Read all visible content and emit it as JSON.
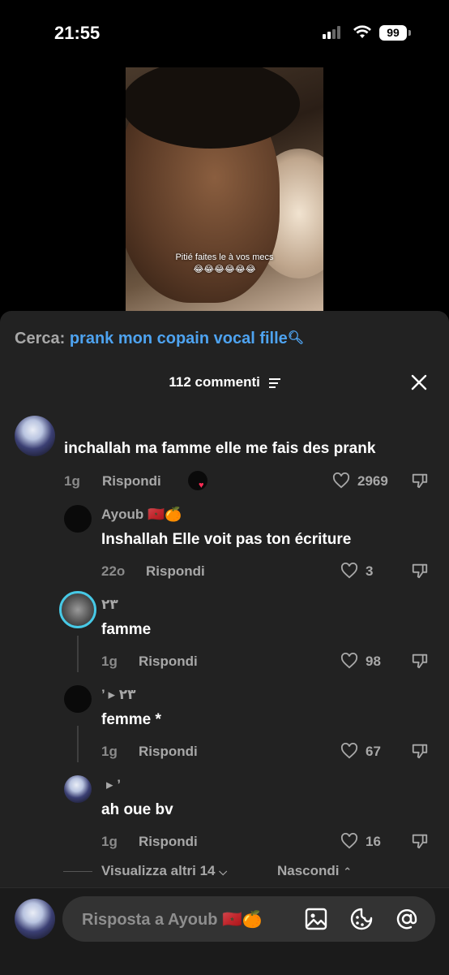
{
  "status_bar": {
    "time": "21:55",
    "battery": "99"
  },
  "video": {
    "caption": "Pitié faites le à vos mecs",
    "caption_emojis": "😂😂😂😂😂😂"
  },
  "search": {
    "label": "Cerca:",
    "query": "prank mon copain vocal fille"
  },
  "comments_header": {
    "count_text": "112 commenti"
  },
  "comments": [
    {
      "name": "",
      "text": "inchallah ma famme elle me fais des prank",
      "age": "1g",
      "reply_label": "Rispondi",
      "likes": "2969"
    },
    {
      "name": "Ayoub 🇲🇦🍊",
      "text": "Inshallah Elle voit pas ton écriture",
      "age": "22o",
      "reply_label": "Rispondi",
      "likes": "3"
    },
    {
      "name": "٢٣",
      "text": "famme",
      "age": "1g",
      "reply_label": "Rispondi",
      "likes": "98"
    },
    {
      "name": "’ ▸ ٢٣",
      "text": "femme *",
      "age": "1g",
      "reply_label": "Rispondi",
      "likes": "67"
    },
    {
      "name": "▸ ’",
      "text": "ah oue bv",
      "age": "1g",
      "reply_label": "Rispondi",
      "likes": "16"
    }
  ],
  "thread_controls": {
    "view_more": "Visualizza altri 14",
    "hide": "Nascondi"
  },
  "composer": {
    "placeholder": "Risposta a Ayoub 🇲🇦🍊"
  },
  "colors": {
    "accent_link": "#4ea3f0",
    "sheet_bg": "#222222",
    "ring": "#47c9e6",
    "heart_red": "#ff2c55"
  },
  "icons": [
    "signal-icon",
    "wifi-icon",
    "battery-icon",
    "search-icon",
    "sort-icon",
    "close-icon",
    "heart-icon",
    "dislike-icon",
    "image-icon",
    "sticker-icon",
    "mention-icon"
  ]
}
